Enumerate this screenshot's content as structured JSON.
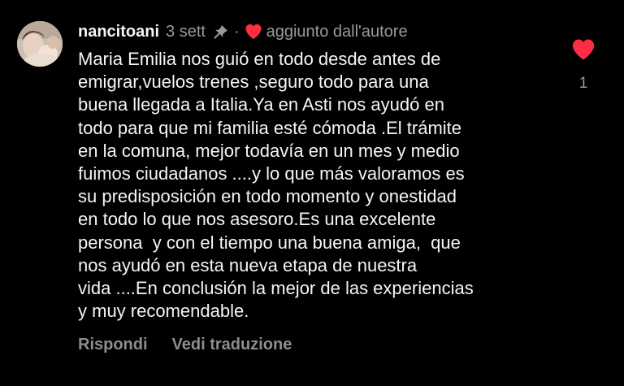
{
  "comment": {
    "username": "nancitoani",
    "time": "3 sett",
    "separator": "·",
    "author_liked_label": "aggiunto dall'autore",
    "lines": [
      "Maria Emilia nos guió en todo desde antes de",
      "emigrar,vuelos trenes ,seguro todo para una",
      "buena llegada a Italia.Ya en Asti nos ayudó en",
      "todo para que mi familia esté cómoda .El trámite",
      "en la comuna, mejor todavía en un mes y medio",
      "fuimos ciudadanos ....y lo que más valoramos es",
      "su predisposición en todo momento y onestidad",
      "en todo lo que nos asesoro.Es una excelente",
      "persona  y con el tiempo una buena amiga,  que",
      "nos ayudó en esta nueva etapa de nuestra",
      "vida ....En conclusión la mejor de las experiencias",
      "y muy recomendable."
    ],
    "actions": {
      "reply_label": "Rispondi",
      "translate_label": "Vedi traduzione"
    },
    "likes": {
      "count": "1"
    }
  },
  "icons": {
    "avatar": "avatar-photo",
    "pin": "pin-icon",
    "author_heart": "heart-icon",
    "like": "heart-icon"
  },
  "colors": {
    "background": "#000000",
    "text_primary": "#f5f5f5",
    "text_secondary": "#9a9a9a",
    "actions": "#8e8e8e",
    "heart_red": "#ff2d44"
  }
}
